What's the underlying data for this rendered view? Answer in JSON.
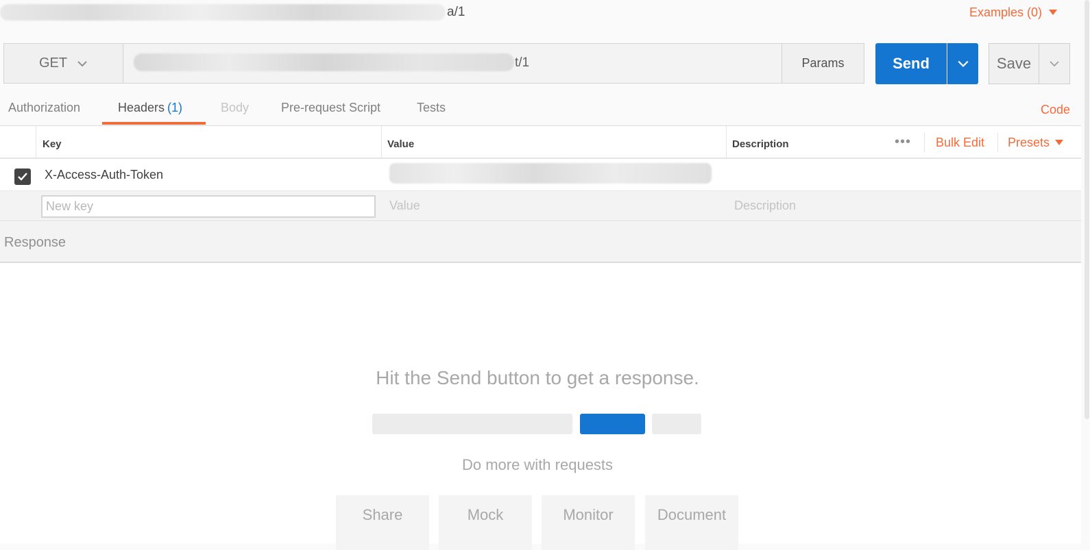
{
  "request": {
    "title_suffix": "a/1",
    "examples_label": "Examples (0)",
    "method": "GET",
    "url_suffix": "t/1",
    "params_label": "Params",
    "send_label": "Send",
    "save_label": "Save"
  },
  "tabs": [
    {
      "label": "Authorization"
    },
    {
      "label": "Headers",
      "count": "(1)"
    },
    {
      "label": "Body"
    },
    {
      "label": "Pre-request Script"
    },
    {
      "label": "Tests"
    }
  ],
  "code_label": "Code",
  "headers_table": {
    "columns": {
      "key": "Key",
      "value": "Value",
      "description": "Description"
    },
    "bulk_edit": "Bulk Edit",
    "presets": "Presets",
    "rows": [
      {
        "key": "X-Access-Auth-Token",
        "checked": true
      }
    ],
    "new_row": {
      "key_placeholder": "New key",
      "value_placeholder": "Value",
      "description_placeholder": "Description"
    }
  },
  "response": {
    "label": "Response",
    "hint": "Hit the Send button to get a response.",
    "do_more": "Do more with requests",
    "cards": [
      "Share",
      "Mock",
      "Monitor",
      "Document"
    ]
  },
  "colors": {
    "accent": "#f26b3a",
    "primary": "#1576d2"
  },
  "icons": {
    "method_dropdown": "chevron-down-icon",
    "send_dropdown": "chevron-down-icon",
    "save_dropdown": "chevron-down-icon",
    "checkbox": "check-icon",
    "more": "ellipsis-icon"
  }
}
